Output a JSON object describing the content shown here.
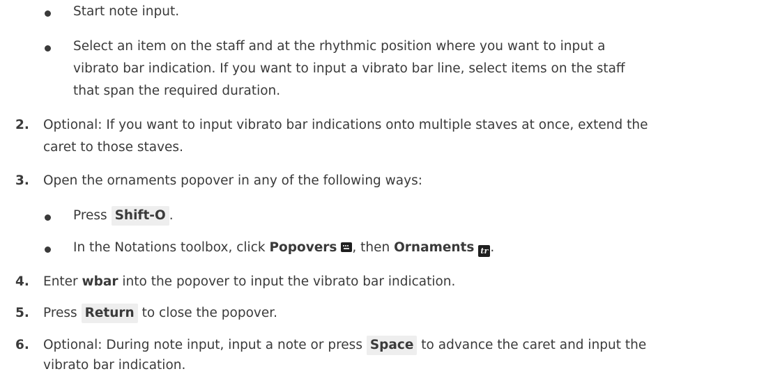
{
  "step1_bullets": [
    {
      "text": "Start note input."
    },
    {
      "line1": "Select an item on the staff and at the rhythmic position where you want to input a",
      "line2": "vibrato bar indication. If you want to input a vibrato bar line, select items on the staff",
      "line3": "that span the required duration."
    }
  ],
  "step2": {
    "num": "2.",
    "line1": "Optional: If you want to input vibrato bar indications onto multiple staves at once, extend the",
    "line2": "caret to those staves."
  },
  "step3": {
    "num": "3.",
    "text": "Open the ornaments popover in any of the following ways:",
    "bullet1": {
      "prefix": "Press ",
      "key": "Shift-O",
      "suffix": "."
    },
    "bullet2": {
      "prefix": "In the Notations toolbox, click ",
      "popovers": "Popovers",
      "popovers_icon": "keyboard-icon",
      "middle": ", then ",
      "ornaments": "Ornaments",
      "ornaments_icon_glyph": "tr",
      "suffix": "."
    }
  },
  "step4": {
    "num": "4.",
    "prefix": "Enter ",
    "code": "wbar",
    "suffix": " into the popover to input the vibrato bar indication."
  },
  "step5": {
    "num": "5.",
    "prefix": "Press ",
    "key": "Return",
    "suffix": " to close the popover."
  },
  "step6": {
    "num": "6.",
    "prefix": "Optional: During note input, input a note or press ",
    "key": "Space",
    "suffix": " to advance the caret and input the",
    "line2": "vibrato bar indication."
  }
}
